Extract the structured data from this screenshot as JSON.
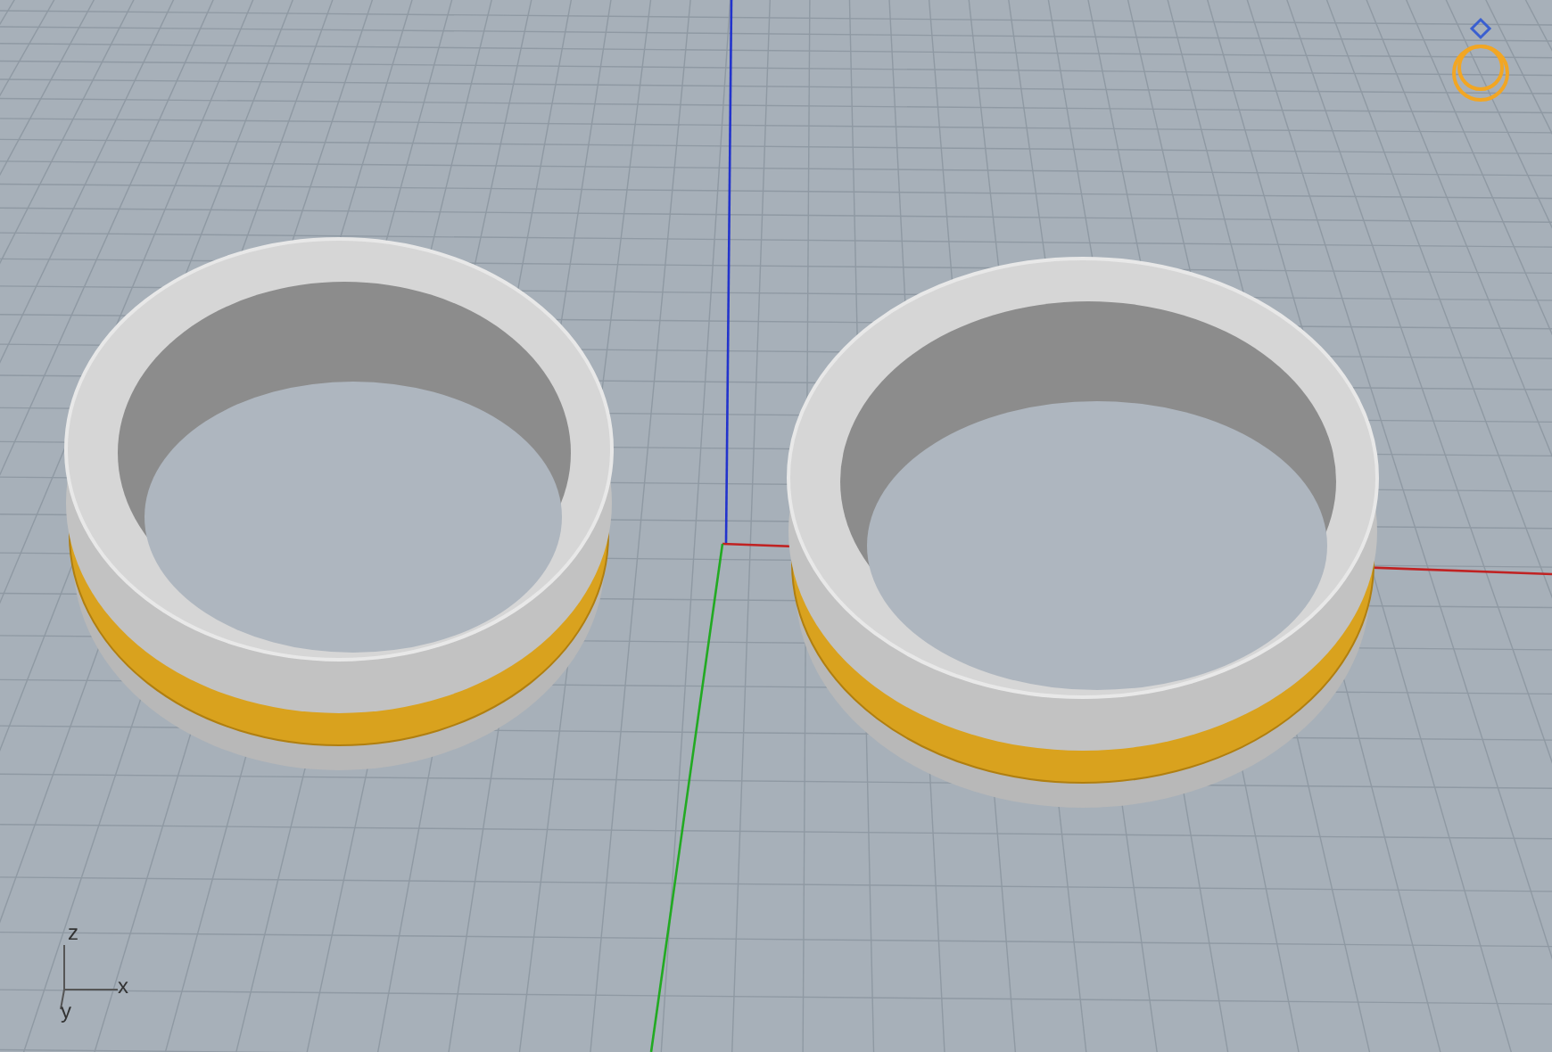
{
  "viewport": {
    "axis_gizmo": {
      "labels": [
        "z",
        "x",
        "y"
      ]
    }
  }
}
